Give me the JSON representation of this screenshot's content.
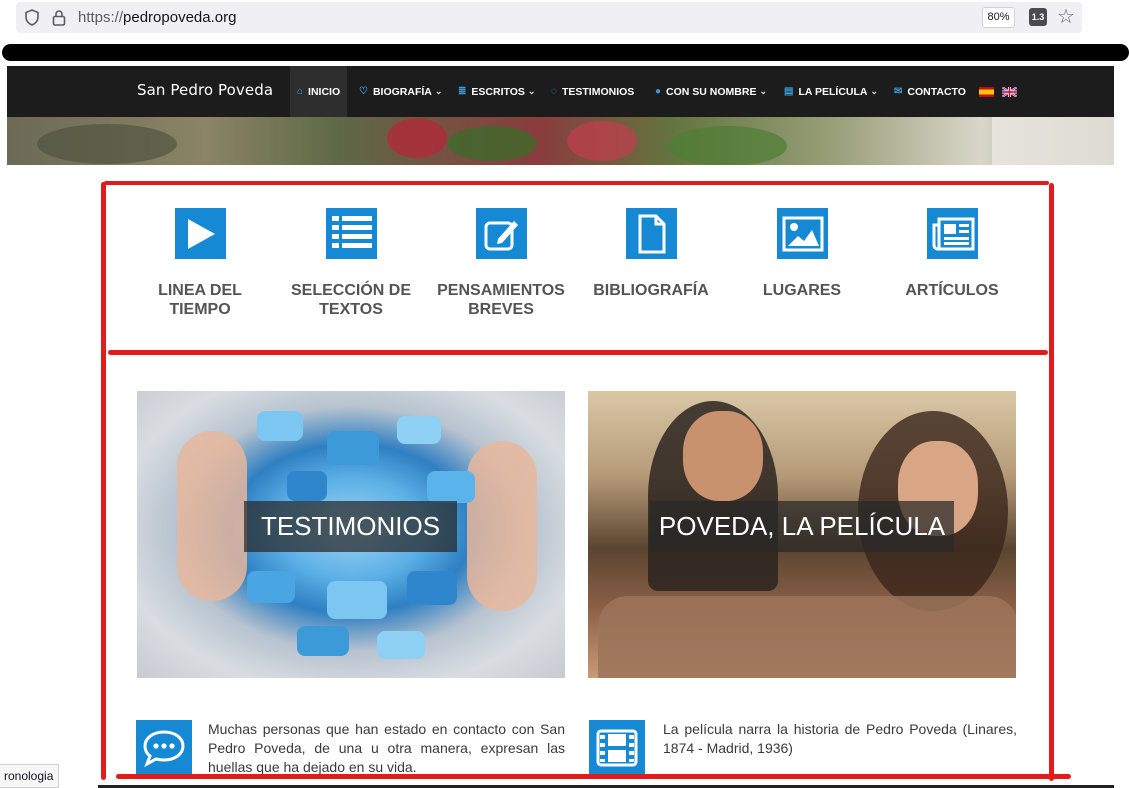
{
  "browser": {
    "url_scheme": "https://",
    "url_host": "pedropoveda.org",
    "zoom": "80%",
    "extension_badge": "1.3"
  },
  "site": {
    "brand": "San Pedro Poveda",
    "nav": [
      {
        "label": "INICIO",
        "icon": "home-icon"
      },
      {
        "label": "BIOGRAFÍA",
        "icon": "heart-icon",
        "dropdown": true
      },
      {
        "label": "ESCRITOS",
        "icon": "list-icon",
        "dropdown": true
      },
      {
        "label": "TESTIMONIOS",
        "icon": "comment-icon"
      },
      {
        "label": "CON SU NOMBRE",
        "icon": "globe-icon",
        "dropdown": true
      },
      {
        "label": "LA PELÍCULA",
        "icon": "film-icon",
        "dropdown": true
      },
      {
        "label": "CONTACTO",
        "icon": "envelope-icon"
      }
    ],
    "languages": [
      "es",
      "en"
    ]
  },
  "tiles": [
    {
      "line1": "LINEA DEL",
      "line2": "TIEMPO",
      "icon": "play-icon"
    },
    {
      "line1": "SELECCIÓN DE",
      "line2": "TEXTOS",
      "icon": "list-icon"
    },
    {
      "line1": "PENSAMIENTOS",
      "line2": "BREVES",
      "icon": "edit-icon"
    },
    {
      "line1": "BIBLIOGRAFÍA",
      "line2": "",
      "icon": "document-icon"
    },
    {
      "line1": "LUGARES",
      "line2": "",
      "icon": "image-icon"
    },
    {
      "line1": "ARTÍCULOS",
      "line2": "",
      "icon": "newspaper-icon"
    }
  ],
  "features": [
    {
      "caption": "TESTIMONIOS",
      "icon": "speech-bubble-icon",
      "text": "Muchas personas que han estado en contacto con San Pedro Poveda, de una u otra manera, expresan las huellas que ha dejado en su vida."
    },
    {
      "caption": "POVEDA, LA PELÍCULA",
      "icon": "film-strip-icon",
      "text": "La película narra la historia de Pedro Poveda (Linares, 1874 - Madrid, 1936)"
    }
  ],
  "status_link": "ronologia",
  "colors": {
    "accent": "#1589d3",
    "nav_bg": "#1c1c1c",
    "annotation": "#e31b1b"
  }
}
